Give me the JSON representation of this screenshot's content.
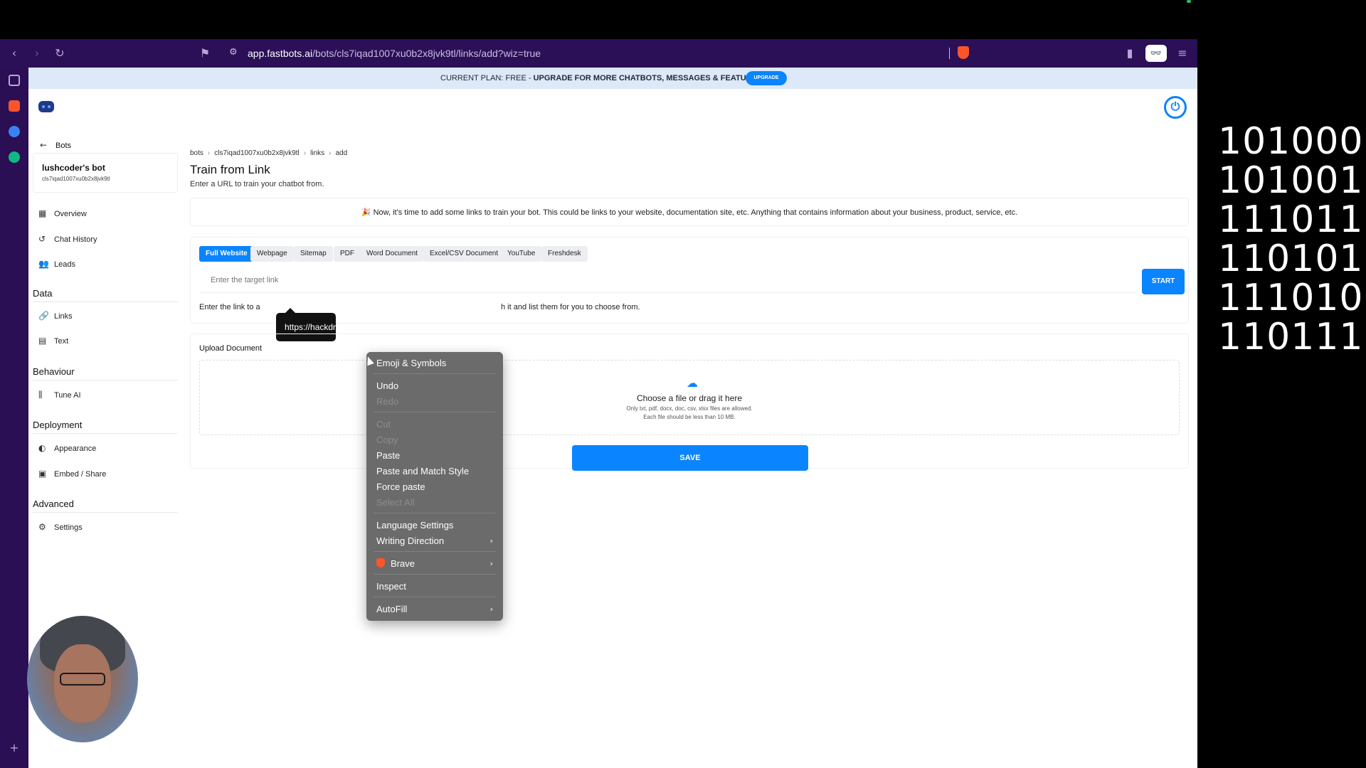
{
  "browser": {
    "url_host": "app.fastbots.ai",
    "url_path": "/bots/cls7iqad1007xu0b2x8jvk9tl/links/add?wiz=true"
  },
  "banner": {
    "plan_text": "CURRENT PLAN: FREE - ",
    "upgrade_text": "UPGRADE FOR MORE CHATBOTS, MESSAGES & FEATURES",
    "upgrade_button": "UPGRADE"
  },
  "sidebar": {
    "back_label": "Bots",
    "bot_name": "lushcoder's bot",
    "bot_id": "cls7iqad1007xu0b2x8jvk9tl",
    "items_top": [
      {
        "label": "Overview",
        "icon": "grid-icon"
      },
      {
        "label": "Chat History",
        "icon": "history-icon"
      },
      {
        "label": "Leads",
        "icon": "users-icon"
      }
    ],
    "sections": [
      {
        "title": "Data",
        "items": [
          {
            "label": "Links",
            "icon": "link-icon"
          },
          {
            "label": "Text",
            "icon": "text-icon"
          }
        ]
      },
      {
        "title": "Behaviour",
        "items": [
          {
            "label": "Tune AI",
            "icon": "sliders-icon"
          }
        ]
      },
      {
        "title": "Deployment",
        "items": [
          {
            "label": "Appearance",
            "icon": "palette-icon"
          },
          {
            "label": "Embed / Share",
            "icon": "embed-icon"
          }
        ]
      },
      {
        "title": "Advanced",
        "items": [
          {
            "label": "Settings",
            "icon": "gear-icon"
          }
        ]
      }
    ]
  },
  "main": {
    "breadcrumb": [
      "bots",
      "cls7iqad1007xu0b2x8jvk9tl",
      "links",
      "add"
    ],
    "title": "Train from Link",
    "subtitle": "Enter a URL to train your chatbot from.",
    "notice": "🎉 Now, it's time to add some links to train your bot. This could be links to your website, documentation site, etc. Anything that contains information about your business, product, service, etc.",
    "tabs": [
      "Full Website",
      "Webpage",
      "Sitemap",
      "PDF",
      "Word Document",
      "Excel/CSV Document",
      "YouTube",
      "Freshdesk"
    ],
    "active_tab": "Full Website",
    "input_placeholder": "Enter the target link",
    "start_button": "START",
    "help_text_start": "Enter the link to a",
    "help_text_end": "h it and list them for you to choose from.",
    "tooltip_text": "https://hackdr",
    "upload_title": "Upload Document",
    "drop_main": "Choose a file or drag it here",
    "drop_sub1": "Only txt, pdf, docx, doc, csv, xlsx files are allowed.",
    "drop_sub2": "Each file should be less than 10 MB.",
    "save_button": "SAVE"
  },
  "context_menu": {
    "emoji": "Emoji & Symbols",
    "undo": "Undo",
    "redo": "Redo",
    "cut": "Cut",
    "copy": "Copy",
    "paste": "Paste",
    "paste_match": "Paste and Match Style",
    "force_paste": "Force paste",
    "select_all": "Select All",
    "language": "Language Settings",
    "writing_direction": "Writing Direction",
    "brave": "Brave",
    "inspect": "Inspect",
    "autofill": "AutoFill"
  },
  "binary_lines": [
    "101000",
    "101001",
    "111011",
    "110101",
    "111010",
    "110111"
  ],
  "colors": {
    "accent": "#0a84ff",
    "browser_chrome": "#2b0f57",
    "banner_bg": "#dde9f9"
  }
}
